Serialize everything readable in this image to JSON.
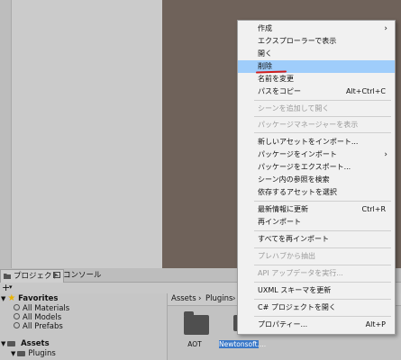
{
  "panel_tabs": [
    {
      "label": "プロジェクト",
      "icon": "folder-icon",
      "active": true
    },
    {
      "label": "コンソール",
      "icon": "console-icon",
      "active": false
    }
  ],
  "toolbar": {
    "add_label": "+",
    "add_dropdown_label": "▾"
  },
  "tree": {
    "favorites": {
      "label": "Favorites",
      "items": [
        "All Materials",
        "All Models",
        "All Prefabs"
      ]
    },
    "assets": {
      "label": "Assets",
      "items": [
        "Plugins"
      ]
    }
  },
  "breadcrumb": [
    "Assets",
    "›",
    "Plugins",
    "›"
  ],
  "assets": [
    {
      "label": "AOT",
      "selected": false
    },
    {
      "label": "Newtonsoft....",
      "selected": true
    }
  ],
  "context_menu": {
    "items": [
      {
        "label": "作成",
        "submenu": true
      },
      {
        "label": "エクスプローラーで表示"
      },
      {
        "label": "開く"
      },
      {
        "label": "削除",
        "highlighted": true
      },
      {
        "label": "名前を変更"
      },
      {
        "label": "パスをコピー",
        "shortcut": "Alt+Ctrl+C"
      },
      {
        "label": "シーンを追加して開く",
        "disabled": true
      },
      {
        "label": "パッケージマネージャーを表示",
        "disabled": true
      },
      {
        "label": "新しいアセットをインポート..."
      },
      {
        "label": "パッケージをインポート",
        "submenu": true
      },
      {
        "label": "パッケージをエクスポート..."
      },
      {
        "label": "シーン内の参照を検索"
      },
      {
        "label": "依存するアセットを選択"
      },
      {
        "label": "最新情報に更新",
        "shortcut": "Ctrl+R"
      },
      {
        "label": "再インポート"
      },
      {
        "label": "すべてを再インポート"
      },
      {
        "label": "プレハブから抽出",
        "disabled": true
      },
      {
        "label": "API アップデータを実行...",
        "disabled": true
      },
      {
        "label": "UXML スキーマを更新"
      },
      {
        "label": "C# プロジェクトを開く"
      },
      {
        "label": "プロパティー...",
        "shortcut": "Alt+P"
      }
    ]
  },
  "colors": {
    "highlight": "#9fcdfb",
    "annotation_underline": "#d21d1d",
    "scene_bg": "#6f625a"
  }
}
